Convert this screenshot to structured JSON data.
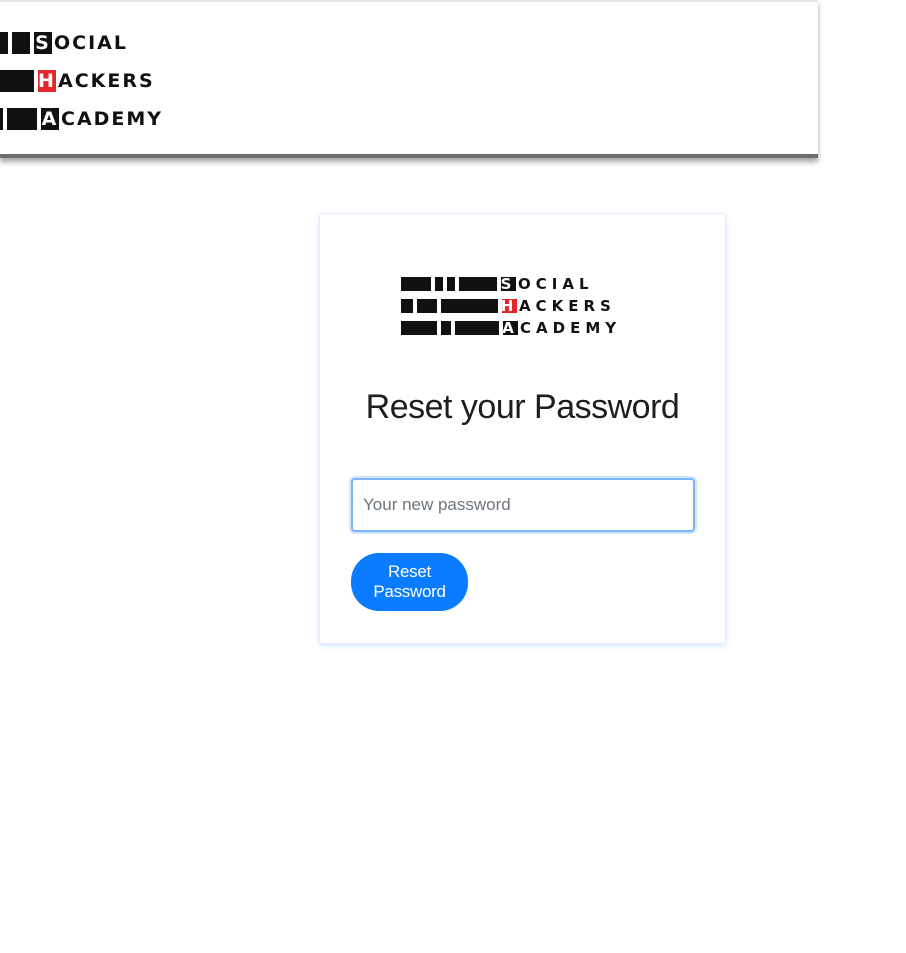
{
  "header": {
    "logo": {
      "rows": [
        {
          "initial": "S",
          "rest": "OCIAL"
        },
        {
          "initial": "H",
          "rest": "ACKERS"
        },
        {
          "initial": "A",
          "rest": "CADEMY"
        }
      ]
    }
  },
  "card": {
    "logo": {
      "rows": [
        {
          "initial": "S",
          "rest": "OCIAL"
        },
        {
          "initial": "H",
          "rest": "ACKERS"
        },
        {
          "initial": "A",
          "rest": "CADEMY"
        }
      ]
    },
    "title": "Reset your Password",
    "password_placeholder": "Your new password",
    "password_value": "",
    "submit_label": "Reset Password"
  },
  "colors": {
    "primary": "#0a7cff",
    "brand_red": "#e4252b",
    "logo_black": "#111111"
  },
  "icons": {
    "brand_logo": "social-hackers-academy-logo"
  }
}
